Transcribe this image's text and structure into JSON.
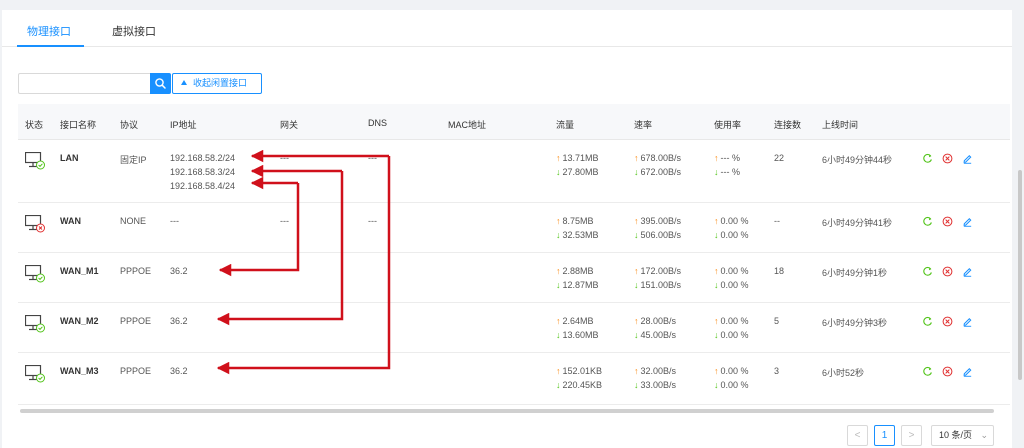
{
  "tabs": [
    {
      "label": "物理接口",
      "active": true
    },
    {
      "label": "虚拟接口",
      "active": false
    }
  ],
  "search": {
    "value": "",
    "placeholder": ""
  },
  "collapse_label": "收起闲置接口",
  "columns": [
    "状态",
    "接口名称",
    "协议",
    "IP地址",
    "网关",
    "DNS",
    "MAC地址",
    "流量",
    "速率",
    "使用率",
    "连接数",
    "上线时间"
  ],
  "rows": [
    {
      "status": "connected",
      "name": "LAN",
      "protocol": "固定IP",
      "ip": [
        "192.168.58.2/24",
        "192.168.58.3/24",
        "192.168.58.4/24"
      ],
      "gateway": "---",
      "dns": "---",
      "mac": "",
      "traffic_up": "13.71MB",
      "traffic_down": "27.80MB",
      "rate_up": "678.00B/s",
      "rate_down": "672.00B/s",
      "usage_up": "--- %",
      "usage_down": "--- %",
      "connections": "22",
      "uptime": "6小时49分钟44秒"
    },
    {
      "status": "disconnected",
      "name": "WAN",
      "protocol": "NONE",
      "ip": [
        "---"
      ],
      "gateway": "---",
      "dns": "---",
      "mac": "",
      "traffic_up": "8.75MB",
      "traffic_down": "32.53MB",
      "rate_up": "395.00B/s",
      "rate_down": "506.00B/s",
      "usage_up": "0.00 %",
      "usage_down": "0.00 %",
      "connections": "--",
      "uptime": "6小时49分钟41秒"
    },
    {
      "status": "connected",
      "name": "WAN_M1",
      "protocol": "PPPOE",
      "ip": [
        "36.2"
      ],
      "gateway": "",
      "dns": "",
      "mac": "",
      "traffic_up": "2.88MB",
      "traffic_down": "12.87MB",
      "rate_up": "172.00B/s",
      "rate_down": "151.00B/s",
      "usage_up": "0.00 %",
      "usage_down": "0.00 %",
      "connections": "18",
      "uptime": "6小时49分钟1秒"
    },
    {
      "status": "connected",
      "name": "WAN_M2",
      "protocol": "PPPOE",
      "ip": [
        "36.2"
      ],
      "gateway": "",
      "dns": "",
      "mac": "",
      "traffic_up": "2.64MB",
      "traffic_down": "13.60MB",
      "rate_up": "28.00B/s",
      "rate_down": "45.00B/s",
      "usage_up": "0.00 %",
      "usage_down": "0.00 %",
      "connections": "5",
      "uptime": "6小时49分钟3秒"
    },
    {
      "status": "connected",
      "name": "WAN_M3",
      "protocol": "PPPOE",
      "ip": [
        "36.2"
      ],
      "gateway": "",
      "dns": "",
      "mac": "",
      "traffic_up": "152.01KB",
      "traffic_down": "220.45KB",
      "rate_up": "32.00B/s",
      "rate_down": "33.00B/s",
      "usage_up": "0.00 %",
      "usage_down": "0.00 %",
      "connections": "3",
      "uptime": "6小时52秒"
    }
  ],
  "pagination": {
    "prev": "<",
    "current": "1",
    "next": ">",
    "page_size": "10 条/页"
  },
  "colors": {
    "accent": "#1890ff",
    "up_arrow": "#fa8c16",
    "down_arrow": "#52c41a",
    "annotation_arrow": "#d0101b",
    "delete": "#e03030"
  },
  "icons": {
    "status": "monitor-icon",
    "search": "search-icon",
    "refresh": "refresh-icon",
    "delete": "close-circle-icon",
    "edit": "edit-icon"
  }
}
